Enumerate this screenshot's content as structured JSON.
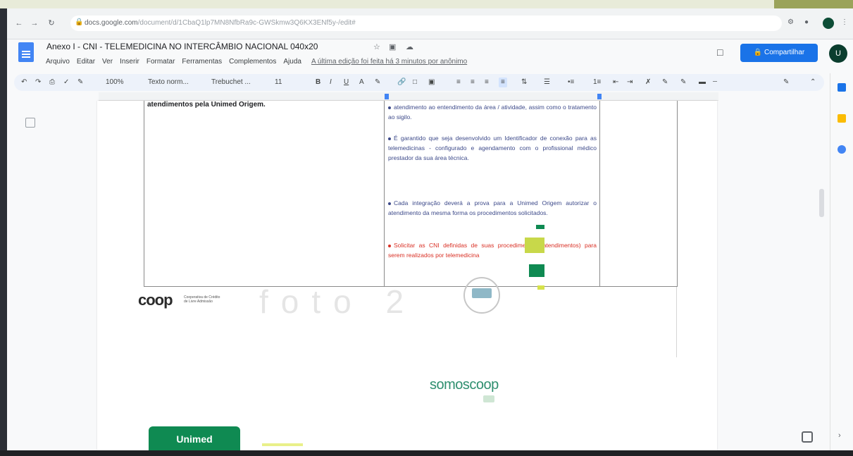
{
  "browser": {
    "url_host": "docs.google.com",
    "url_path": "/document/d/1CbaQ1lp7MN8NfbRa9c-GWSkmw3Q6KX3ENf5y-/edit#"
  },
  "doc": {
    "title": "Anexo I - CNI - TELEMEDICINA NO INTERCÂMBIO NACIONAL 040x20",
    "menu": [
      "Arquivo",
      "Editar",
      "Ver",
      "Inserir",
      "Formatar",
      "Ferramentas",
      "Complementos",
      "Ajuda"
    ],
    "last_edit": "A última edição foi feita há 3 minutos por anônimo",
    "share_label": "Compartilhar",
    "avatar_initial": "U"
  },
  "toolbar": {
    "zoom": "100%",
    "style": "Texto norm...",
    "font": "Trebuchet ...",
    "font_size": "11"
  },
  "page": {
    "left_cell": "atendimentos pela Unimed Origem.",
    "bullets": [
      {
        "text": "atendimento ao entendimento da área / atividade, assim como o tratamento ao sigilo.",
        "color": "#3d4a8a"
      },
      {
        "text": "É garantido que seja desenvolvido um Identificador de conexão para as telemedicinas - configurado e agendamento com o profissional médico prestador da sua área técnica.",
        "color": "#3d4a8a"
      },
      {
        "text": "Cada integração deverá a prova para a Unimed Origem autorizar o atendimento da mesma forma os procedimentos solicitados.",
        "color": "#3d4a8a"
      },
      {
        "text": "Solicitar as CNI definidas de suas procedimentos (atendimentos) para serem realizados por telemedicina",
        "color": "#d93025"
      }
    ],
    "coop_logo": "coop",
    "coop_sub": "Cooperativa de Crédito\nde Livre Admissão",
    "watermark": "foto 2",
    "somos": "somoscoop",
    "unimed": "Unimed"
  },
  "colors": {
    "share": "#1a73e8",
    "unimed_green": "#0f8a52",
    "coop_green": "#2f8f6f",
    "bullet_blue": "#3d4a8a",
    "bullet_red": "#d93025"
  }
}
